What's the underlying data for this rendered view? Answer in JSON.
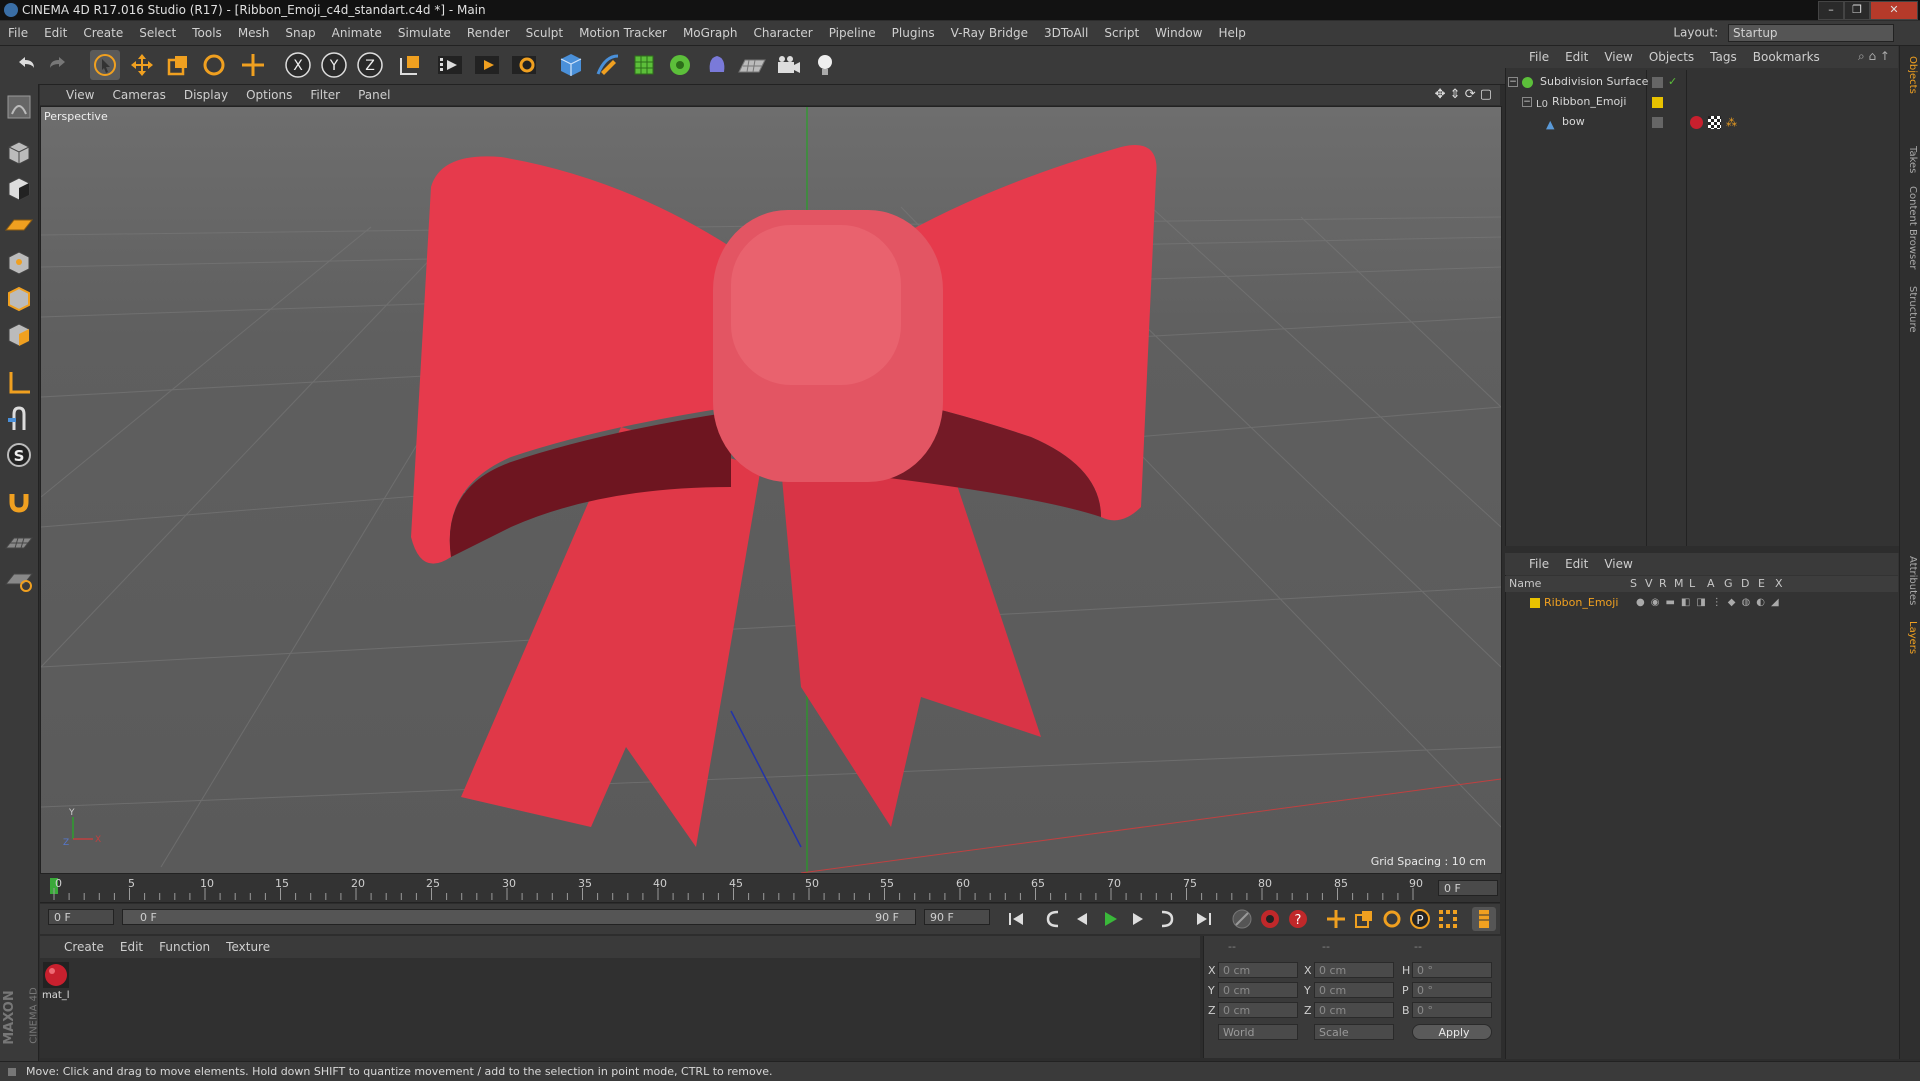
{
  "window": {
    "title": "CINEMA 4D R17.016 Studio (R17) - [Ribbon_Emoji_c4d_standart.c4d *] - Main",
    "controls": [
      "–",
      "❐",
      "✕"
    ]
  },
  "menubar": {
    "items": [
      "File",
      "Edit",
      "Create",
      "Select",
      "Tools",
      "Mesh",
      "Snap",
      "Animate",
      "Simulate",
      "Render",
      "Sculpt",
      "Motion Tracker",
      "MoGraph",
      "Character",
      "Pipeline",
      "Plugins",
      "V-Ray Bridge",
      "3DToAll",
      "Script",
      "Window",
      "Help"
    ],
    "layout_label": "Layout:",
    "layout_value": "Startup"
  },
  "toolbar": {
    "icons": [
      "undo-icon",
      "redo-icon",
      "select-icon",
      "move-icon",
      "scale-icon",
      "rotate-icon",
      "transform-icon",
      "x-axis-icon",
      "y-axis-icon",
      "z-axis-icon",
      "coordinate-system-icon",
      "render-view-icon",
      "render-picture-viewer-icon",
      "render-settings-icon",
      "cube-icon",
      "pen-icon",
      "subdivision-icon",
      "cloner-icon",
      "deformer-icon",
      "floor-icon",
      "camera-icon",
      "light-icon"
    ],
    "axis_labels": [
      "X",
      "Y",
      "Z"
    ]
  },
  "viewport": {
    "menu": [
      "View",
      "Cameras",
      "Display",
      "Options",
      "Filter",
      "Panel"
    ],
    "label": "Perspective",
    "grid_spacing": "Grid Spacing : 10 cm"
  },
  "timeline": {
    "ticks": [
      "0",
      "5",
      "10",
      "15",
      "20",
      "25",
      "30",
      "35",
      "40",
      "45",
      "50",
      "55",
      "60",
      "65",
      "70",
      "75",
      "80",
      "85",
      "90"
    ],
    "current_frame": "0 F",
    "start_field": "0 F",
    "range_start": "0 F",
    "range_end": "90 F",
    "end_field": "90 F"
  },
  "material_manager": {
    "menu": [
      "Create",
      "Edit",
      "Function",
      "Texture"
    ],
    "materials": [
      {
        "name": "mat_l",
        "color": "#c8202e"
      }
    ]
  },
  "coordinates": {
    "header": [
      "--",
      "--",
      "--"
    ],
    "rows": [
      {
        "a": "X",
        "a_val": "0 cm",
        "b": "X",
        "b_val": "0 cm",
        "c": "H",
        "c_val": "0 °"
      },
      {
        "a": "Y",
        "a_val": "0 cm",
        "b": "Y",
        "b_val": "0 cm",
        "c": "P",
        "c_val": "0 °"
      },
      {
        "a": "Z",
        "a_val": "0 cm",
        "b": "Z",
        "b_val": "0 cm",
        "c": "B",
        "c_val": "0 °"
      }
    ],
    "mode": "World",
    "size_mode": "Scale",
    "apply": "Apply"
  },
  "object_manager": {
    "menu": [
      "File",
      "Edit",
      "View",
      "Objects",
      "Tags",
      "Bookmarks"
    ],
    "objects": [
      {
        "name": "Subdivision Surface"
      },
      {
        "name": "Ribbon_Emoji"
      },
      {
        "name": "bow"
      }
    ]
  },
  "layer_manager": {
    "menu": [
      "File",
      "Edit",
      "View"
    ],
    "columns": [
      "Name",
      "S",
      "V",
      "R",
      "M",
      "L",
      "A",
      "G",
      "D",
      "E",
      "X"
    ],
    "layers": [
      {
        "name": "Ribbon_Emoji",
        "color": "#e8c200"
      }
    ]
  },
  "side_tabs": [
    "Objects",
    "Takes",
    "Content Browser",
    "Structure",
    "Attributes",
    "Layers"
  ],
  "status": "Move: Click and drag to move elements. Hold down SHIFT to quantize movement / add to the selection in point mode, CTRL to remove.",
  "brand": [
    "MAXON",
    "CINEMA 4D"
  ],
  "colors": {
    "ribbon": "#e0394a",
    "accent_orange": "#f0a020",
    "bg": "#3a3a3a"
  }
}
